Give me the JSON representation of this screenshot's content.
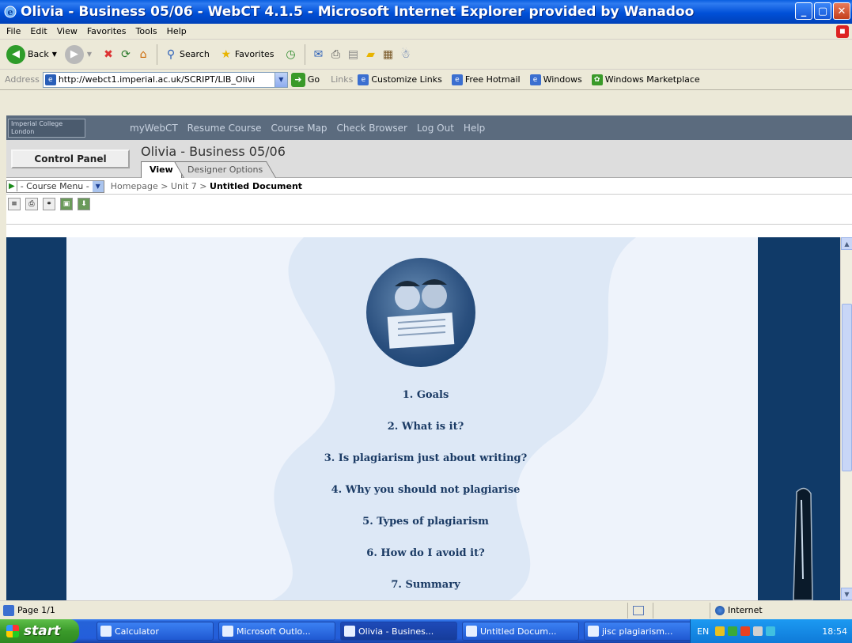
{
  "window": {
    "title": "Olivia - Business 05/06 - WebCT 4.1.5 - Microsoft Internet Explorer provided by Wanadoo"
  },
  "menu": [
    "File",
    "Edit",
    "View",
    "Favorites",
    "Tools",
    "Help"
  ],
  "toolbar": {
    "back": "Back",
    "search": "Search",
    "favorites": "Favorites"
  },
  "address": {
    "label": "Address",
    "url": "http://webct1.imperial.ac.uk/SCRIPT/LIB_Olivi",
    "go": "Go",
    "links_label": "Links",
    "links": [
      "Customize Links",
      "Free Hotmail",
      "Windows",
      "Windows Marketplace"
    ]
  },
  "webct": {
    "logo": "Imperial College London",
    "nav": [
      "myWebCT",
      "Resume Course",
      "Course Map",
      "Check Browser",
      "Log Out",
      "Help"
    ],
    "control_panel": "Control Panel",
    "course_title": "Olivia - Business 05/06",
    "tabs": [
      "View",
      "Designer Options"
    ],
    "course_menu": "- Course Menu -",
    "breadcrumb": {
      "path": "Homepage > Unit 7 > ",
      "current": "Untitled Document"
    }
  },
  "content": {
    "toc": [
      "1. Goals",
      "2. What is it?",
      "3. Is plagiarism just about writing?",
      "4. Why you should not plagiarise",
      "5. Types of plagiarism",
      "6. How do I avoid it?",
      "7. Summary"
    ]
  },
  "status": {
    "page": "Page 1/1",
    "zone": "Internet"
  },
  "taskbar": {
    "start": "start",
    "tasks": [
      "Calculator",
      "Microsoft Outlo...",
      "Olivia - Busines...",
      "Untitled Docum...",
      "jisc plagiarism..."
    ],
    "lang": "EN",
    "clock": "18:54"
  },
  "colors": {
    "xp_blue": "#0050d8",
    "webct_nav": "#5b6b7e",
    "content_dark": "#103a68",
    "toc_text": "#1a3a64"
  }
}
